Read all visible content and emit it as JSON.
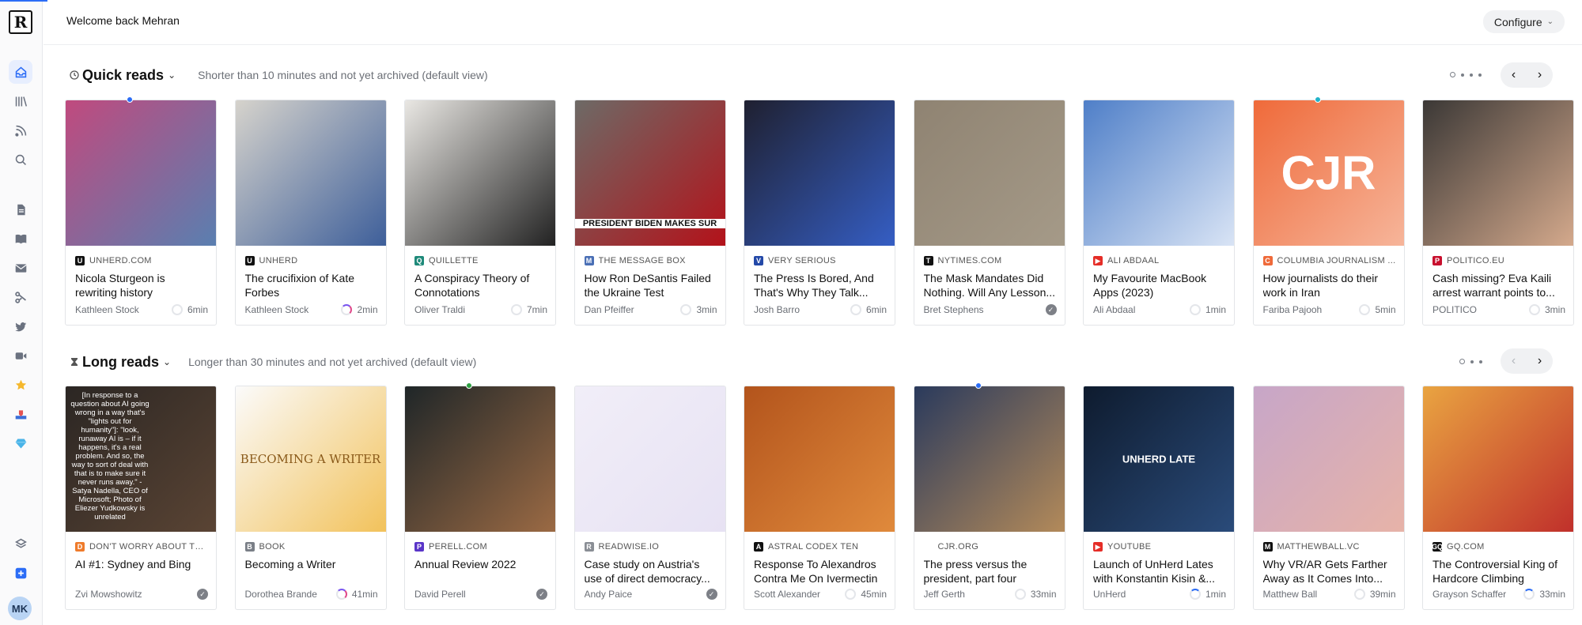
{
  "header": {
    "welcome": "Welcome back Mehran",
    "configure_label": "Configure"
  },
  "sidebar": {
    "logo": "R",
    "avatar": "MK",
    "icons": [
      "home-icon",
      "library-icon",
      "feed-icon",
      "search-icon",
      "document-icon",
      "book-icon",
      "mail-icon",
      "readwise-icon",
      "twitter-icon",
      "video-icon",
      "star-icon",
      "inbox-tray-icon",
      "diamond-icon",
      "layers-icon",
      "plus-icon"
    ]
  },
  "quick": {
    "title": "Quick reads",
    "desc": "Shorter than 10 minutes and not yet archived (default view)",
    "cards": [
      {
        "site": "UNHERD.COM",
        "title": "Nicola Sturgeon is rewriting history",
        "author": "Kathleen Stock",
        "time": "6min",
        "fav": "U",
        "favColor": "#111111",
        "thumb": "#c04a7e",
        "thumb2": "#5a7fb0",
        "prog": "empty",
        "unread": "#2c6df6"
      },
      {
        "site": "UNHERD",
        "title": "The crucifixion of Kate Forbes",
        "author": "Kathleen Stock",
        "time": "2min",
        "fav": "U",
        "favColor": "#111111",
        "thumb": "#d6d3cc",
        "thumb2": "#3e5f9a",
        "prog": "partial"
      },
      {
        "site": "QUILLETTE",
        "title": "A Conspiracy Theory of Connotations",
        "author": "Oliver Traldi",
        "time": "7min",
        "fav": "Q",
        "favColor": "#1f8a7a",
        "thumb": "#e9e7e3",
        "thumb2": "#222222",
        "prog": "empty"
      },
      {
        "site": "THE MESSAGE BOX",
        "title": "How Ron DeSantis Failed the Ukraine Test",
        "author": "Dan Pfeiffer",
        "time": "3min",
        "fav": "M",
        "favColor": "#4a6fb5",
        "thumb": "#6d6a66",
        "thumb2": "#b3121a",
        "prog": "empty",
        "overlay": "PRESIDENT BIDEN MAKES SUR"
      },
      {
        "site": "VERY SERIOUS",
        "title": "The Press Is Bored, And That's Why They Talk...",
        "author": "Josh Barro",
        "time": "6min",
        "fav": "V",
        "favColor": "#2449a8",
        "thumb": "#1f2030",
        "thumb2": "#355ec4",
        "prog": "empty"
      },
      {
        "site": "NYTIMES.COM",
        "title": "The Mask Mandates Did Nothing. Will Any Lesson...",
        "author": "Bret Stephens",
        "time": "",
        "fav": "T",
        "favColor": "#111111",
        "thumb": "#8f8372",
        "thumb2": "#a59a88",
        "prog": "done"
      },
      {
        "site": "ALI ABDAAL",
        "title": "My Favourite MacBook Apps (2023)",
        "author": "Ali Abdaal",
        "time": "1min",
        "fav": "▶",
        "favColor": "#e52d27",
        "thumb": "#4f7fc8",
        "thumb2": "#d9e4f5",
        "prog": "empty"
      },
      {
        "site": "COLUMBIA JOURNALISM ...",
        "title": "How journalists do their work in Iran",
        "author": "Fariba Pajooh",
        "time": "5min",
        "fav": "C",
        "favColor": "#ef6a3a",
        "thumb": "#ef6a3a",
        "thumb2": "#f6b59a",
        "prog": "empty",
        "overlay": "CJR",
        "unread": "#21b3c9"
      },
      {
        "site": "POLITICO.EU",
        "title": "Cash missing? Eva Kaili arrest warrant points to...",
        "author": "POLITICO",
        "time": "3min",
        "fav": "P",
        "favColor": "#c8102e",
        "thumb": "#3b3836",
        "thumb2": "#d4a98c",
        "prog": "empty"
      }
    ]
  },
  "long": {
    "title": "Long reads",
    "desc": "Longer than 30 minutes and not yet archived (default view)",
    "cards": [
      {
        "site": "DON'T WORRY ABOUT TH...",
        "title": "AI #1: Sydney and Bing",
        "author": "Zvi Mowshowitz",
        "time": "",
        "fav": "D",
        "favColor": "#ef7b2b",
        "thumb": "#2b2623",
        "thumb2": "#5a4434",
        "prog": "done",
        "overlay": "[In response to a question about AI going wrong in a way that's \"lights out for humanity\"]: \"look, runaway AI is – if it happens, it's a real problem. And so, the way to sort of deal with that is to make sure it never runs away.\" -Satya Nadella, CEO of Microsoft; Photo of Eliezer Yudkowsky is unrelated"
      },
      {
        "site": "BOOK",
        "title": "Becoming a Writer",
        "author": "Dorothea Brande",
        "time": "41min",
        "fav": "B",
        "favColor": "#7a7f87",
        "thumb": "#fbfbfb",
        "thumb2": "#f2c25b",
        "prog": "partial",
        "overlay": "BECOMING A WRITER"
      },
      {
        "site": "PERELL.COM",
        "title": "Annual Review 2022",
        "author": "David Perell",
        "time": "",
        "fav": "P",
        "favColor": "#5a35c8",
        "thumb": "#1f2628",
        "thumb2": "#9b6a44",
        "prog": "done",
        "unread": "#2ea043"
      },
      {
        "site": "READWISE.IO",
        "title": "Case study on Austria's use of direct democracy...",
        "author": "Andy Paice",
        "time": "",
        "fav": "R",
        "favColor": "#8a8e95",
        "thumb": "#f1eef8",
        "thumb2": "#e7e2f3",
        "prog": "done"
      },
      {
        "site": "ASTRAL CODEX TEN",
        "title": "Response To Alexandros Contra Me On Ivermectin",
        "author": "Scott Alexander",
        "time": "45min",
        "fav": "A",
        "favColor": "#111111",
        "thumb": "#b3541c",
        "thumb2": "#e08a3c",
        "prog": "empty"
      },
      {
        "site": "CJR.ORG",
        "title": "The press versus the president, part four",
        "author": "Jeff Gerth",
        "time": "33min",
        "fav": "",
        "favColor": "#ffffff",
        "thumb": "#2a3a5c",
        "thumb2": "#b38a5a",
        "prog": "empty",
        "unread": "#2c6df6"
      },
      {
        "site": "YOUTUBE",
        "title": "Launch of UnHerd Lates with Konstantin Kisin &...",
        "author": "UnHerd",
        "time": "1min",
        "fav": "▶",
        "favColor": "#e52d27",
        "thumb": "#0e1b2e",
        "thumb2": "#2a4b7a",
        "prog": "tiny",
        "overlay": "UNHERD LATE"
      },
      {
        "site": "MATTHEWBALL.VC",
        "title": "Why VR/AR Gets Farther Away as It Comes Into...",
        "author": "Matthew Ball",
        "time": "39min",
        "fav": "M",
        "favColor": "#111111",
        "thumb": "#c7a6c8",
        "thumb2": "#e7b3a8",
        "prog": "empty"
      },
      {
        "site": "GQ.COM",
        "title": "The Controversial King of Hardcore Climbing",
        "author": "Grayson Schaffer",
        "time": "33min",
        "fav": "GQ",
        "favColor": "#111111",
        "thumb": "#e9a441",
        "thumb2": "#c0302b",
        "prog": "tiny"
      }
    ]
  }
}
